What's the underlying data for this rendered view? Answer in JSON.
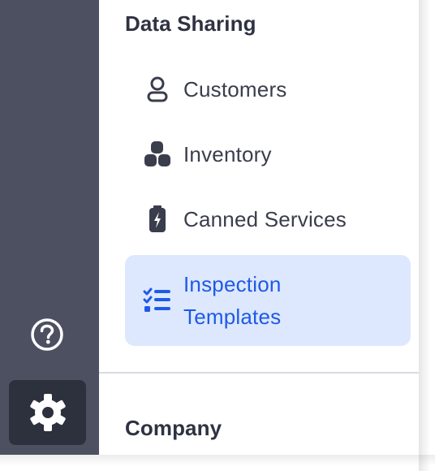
{
  "sidebar_rail": {
    "help_icon": "question-circle-icon",
    "settings_icon": "gear-icon"
  },
  "data_sharing": {
    "heading": "Data Sharing",
    "items": [
      {
        "label": "Customers",
        "icon": "person-icon"
      },
      {
        "label": "Inventory",
        "icon": "boxes-icon"
      },
      {
        "label": "Canned Services",
        "icon": "battery-bolt-icon"
      },
      {
        "label_line1": "Inspection",
        "label_line2": "Templates",
        "icon": "checklist-icon",
        "active": true
      }
    ]
  },
  "company": {
    "heading": "Company"
  },
  "colors": {
    "rail_background": "#4d5061",
    "settings_button_background": "#2d303d",
    "active_background": "#dde8fe",
    "active_text": "#1f5ae6",
    "text": "#3a3d4c"
  }
}
